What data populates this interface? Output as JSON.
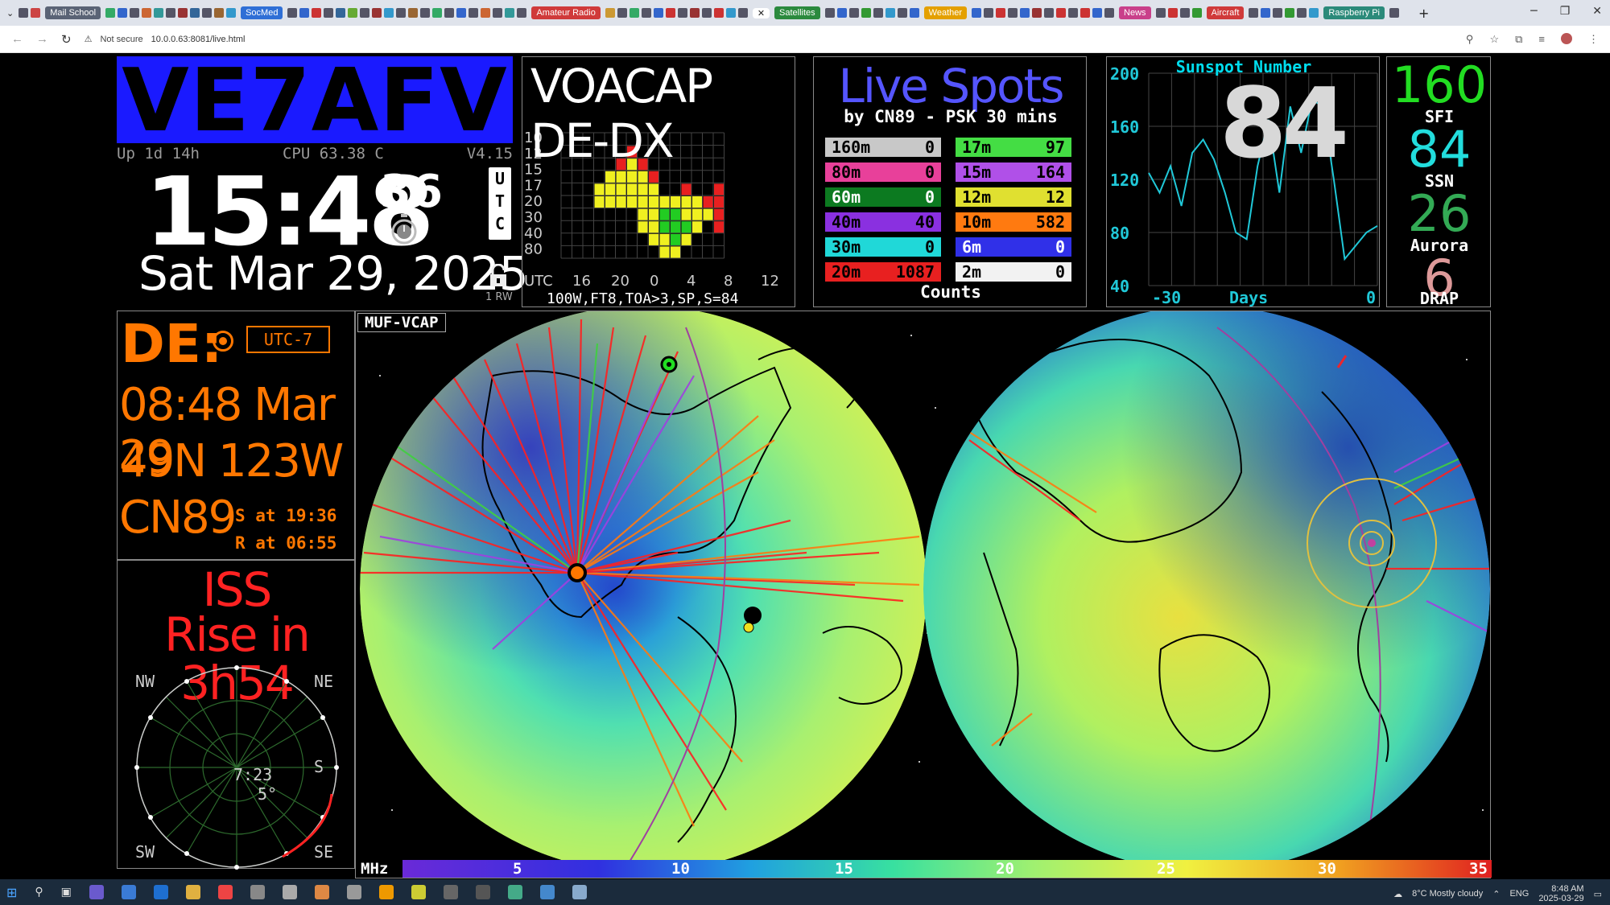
{
  "browser": {
    "tab_pills": [
      {
        "label": "Mail School",
        "color": "#5a6375"
      },
      {
        "label": "SocMed",
        "color": "#2f6fd6"
      },
      {
        "label": "Amateur Radio",
        "color": "#d03a3a"
      },
      {
        "label": "Satellites",
        "color": "#2b8a3e"
      },
      {
        "label": "Weather",
        "color": "#e4a000"
      },
      {
        "label": "News",
        "color": "#c9408a"
      },
      {
        "label": "Aircraft",
        "color": "#d03a3a"
      },
      {
        "label": "Raspberry Pi",
        "color": "#2b8a7a"
      }
    ],
    "new_tab": "+",
    "address_security": "Not secure",
    "address_url": "10.0.0.63:8081/live.html"
  },
  "callsign": {
    "text": "VE7AFV",
    "bg": "#1a1aff"
  },
  "status": {
    "uptime": "Up  1d 14h",
    "cpu": "CPU 63.38 C",
    "version": "V4.15"
  },
  "clock": {
    "hhmm": "15:48",
    "seconds": "36",
    "utc_letters": [
      "U",
      "T",
      "C"
    ],
    "date": "Sat  Mar 29, 2025",
    "lock_label": "1 RW"
  },
  "voacap": {
    "title": "VOACAP DE-DX",
    "y_labels": [
      "10",
      "12",
      "15",
      "17",
      "20",
      "30",
      "40",
      "80"
    ],
    "x_labels": [
      "UTC",
      "16",
      "20",
      "0",
      "4",
      "8",
      "12"
    ],
    "footer": "100W,FT8,TOA>3,SP,S=84"
  },
  "live_spots": {
    "title": "Live Spots",
    "subtitle": "by CN89 - PSK 30 mins",
    "footer": "Counts",
    "bands": [
      {
        "band": "160m",
        "count": "0",
        "bg": "#c8c8c8",
        "fg": "#000"
      },
      {
        "band": "17m",
        "count": "97",
        "bg": "#44dd44",
        "fg": "#000"
      },
      {
        "band": "80m",
        "count": "0",
        "bg": "#e8409a",
        "fg": "#000"
      },
      {
        "band": "15m",
        "count": "164",
        "bg": "#b050e8",
        "fg": "#000"
      },
      {
        "band": "60m",
        "count": "0",
        "bg": "#0c7a20",
        "fg": "#fff"
      },
      {
        "band": "12m",
        "count": "12",
        "bg": "#e0e030",
        "fg": "#000"
      },
      {
        "band": "40m",
        "count": "40",
        "bg": "#8a30e0",
        "fg": "#000"
      },
      {
        "band": "10m",
        "count": "582",
        "bg": "#ff7a10",
        "fg": "#000"
      },
      {
        "band": "30m",
        "count": "0",
        "bg": "#20d8d8",
        "fg": "#000"
      },
      {
        "band": "6m",
        "count": "0",
        "bg": "#3030e8",
        "fg": "#fff"
      },
      {
        "band": "20m",
        "count": "1087",
        "bg": "#e82020",
        "fg": "#000"
      },
      {
        "band": "2m",
        "count": "0",
        "bg": "#f2f2f2",
        "fg": "#000"
      }
    ]
  },
  "sunspot": {
    "title": "Sunspot Number",
    "value": "84",
    "y_labels": [
      "200",
      "160",
      "120",
      "80",
      "40"
    ],
    "x_left": "-30",
    "x_mid": "Days",
    "x_right": "0",
    "line_color": "#20c8d8"
  },
  "indices": [
    {
      "value": "160",
      "label": "SFI",
      "color": "#22dd22"
    },
    {
      "value": "84",
      "label": "SSN",
      "color": "#22dddd"
    },
    {
      "value": "26",
      "label": "Aurora",
      "color": "#33aa55"
    },
    {
      "value": "6",
      "label": "DRAP",
      "color": "#dd9999"
    }
  ],
  "de": {
    "title": "DE:",
    "tz": "UTC-7",
    "local_time": "08:48 Mar 29",
    "latlon": "49N  123W",
    "grid": "CN89",
    "sunset": "S at 19:36",
    "sunrise": "R at 06:55"
  },
  "iss": {
    "line1": "ISS",
    "line2": "Rise in  3h54",
    "dirs": {
      "nw": "NW",
      "ne": "NE",
      "sw": "SW",
      "se": "SE",
      "s": "S"
    },
    "pass_time": "7:23",
    "pass_elev": "5°"
  },
  "map": {
    "mode_label": "MUF-VCAP",
    "scale_label": "MHz",
    "scale_ticks": [
      "5",
      "10",
      "15",
      "20",
      "25",
      "30",
      "35"
    ]
  },
  "taskbar": {
    "weather": "8°C  Mostly cloudy",
    "lang": "ENG",
    "time": "8:48 AM",
    "date": "2025-03-29"
  }
}
